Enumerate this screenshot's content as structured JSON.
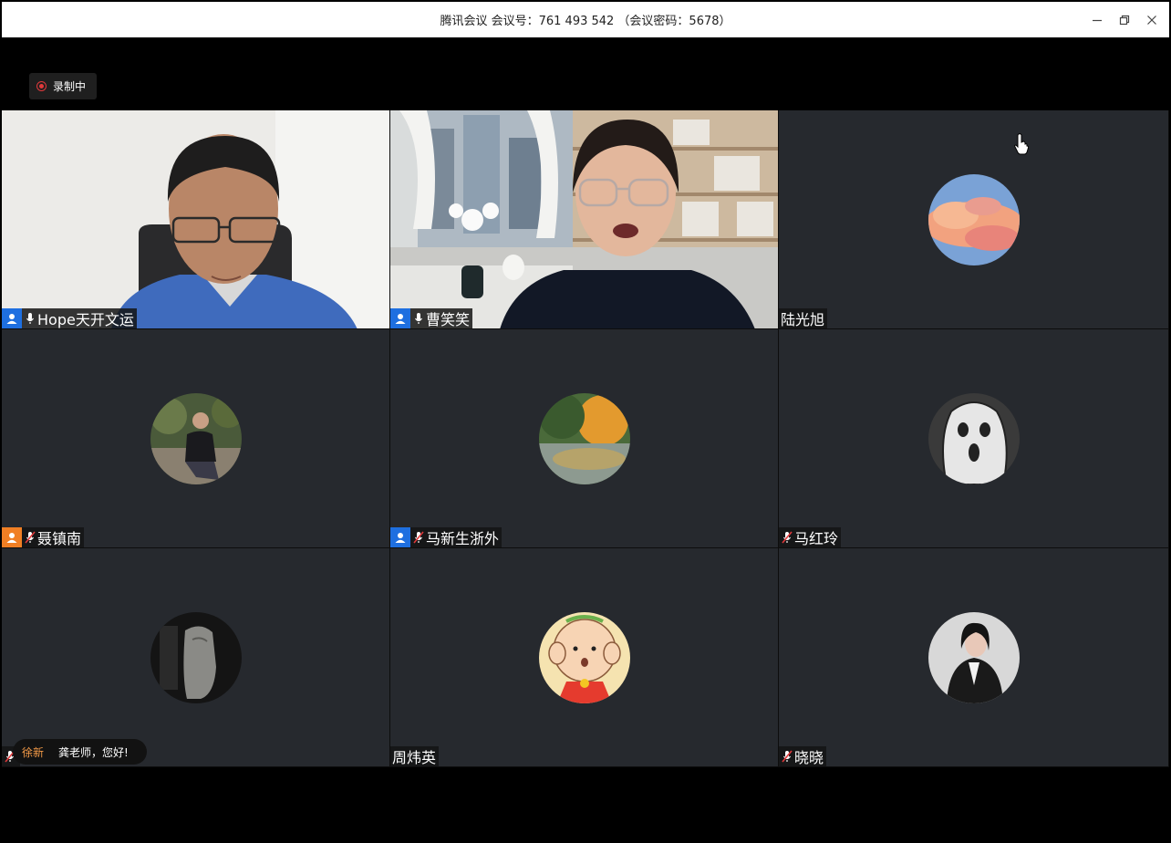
{
  "window": {
    "title": "腾讯会议 会议号：761 493 542 （会议密码：5678）",
    "controls": [
      "minimize-icon",
      "restore-icon",
      "close-icon"
    ]
  },
  "recording": {
    "label": "录制中",
    "color": "#e0393b"
  },
  "participants": [
    {
      "name": "Hope天开文运",
      "video": true,
      "role": "blue",
      "mic": "on",
      "speaking": false
    },
    {
      "name": "曹笑笑",
      "video": true,
      "role": "blue",
      "mic": "on",
      "speaking": true
    },
    {
      "name": "陆光旭",
      "video": false,
      "avatar": "sunset-clouds",
      "role": null,
      "mic": null
    },
    {
      "name": "聂镇南",
      "video": false,
      "avatar": "person-outdoors",
      "role": "orange",
      "mic": "muted"
    },
    {
      "name": "马新生浙外",
      "video": false,
      "avatar": "autumn-pond",
      "role": "blue",
      "mic": "muted"
    },
    {
      "name": "马红玲",
      "video": false,
      "avatar": "scream-sketch",
      "role": null,
      "mic": "muted"
    },
    {
      "name": "",
      "video": false,
      "avatar": "dark-sculpture",
      "role": null,
      "mic": "muted"
    },
    {
      "name": "周炜英",
      "video": false,
      "avatar": "cartoon-baby",
      "role": null,
      "mic": null
    },
    {
      "name": "晓晓",
      "video": false,
      "avatar": "woman-in-black",
      "role": null,
      "mic": "muted"
    }
  ],
  "chat_bubble": {
    "sender": "徐新",
    "message": "龚老师，您好!"
  },
  "colors": {
    "active_border": "#3bb466",
    "tile_bg": "#26292e",
    "role_blue": "#1e6fe0",
    "role_orange": "#f07f24"
  }
}
